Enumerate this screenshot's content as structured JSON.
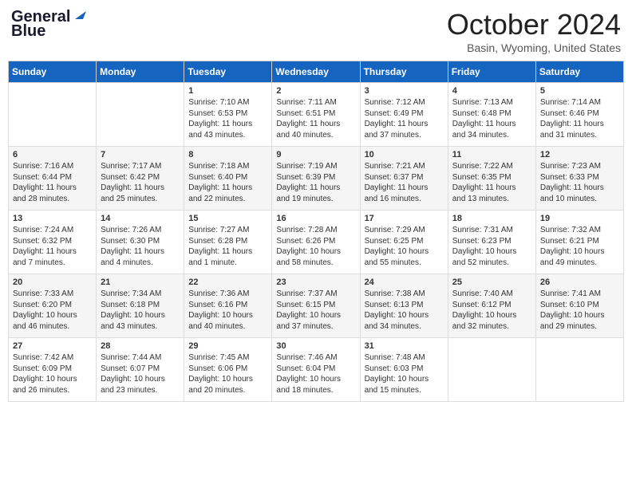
{
  "logo": {
    "line1": "General",
    "line2": "Blue"
  },
  "title": "October 2024",
  "location": "Basin, Wyoming, United States",
  "days_of_week": [
    "Sunday",
    "Monday",
    "Tuesday",
    "Wednesday",
    "Thursday",
    "Friday",
    "Saturday"
  ],
  "weeks": [
    [
      {
        "day": "",
        "content": ""
      },
      {
        "day": "",
        "content": ""
      },
      {
        "day": "1",
        "content": "Sunrise: 7:10 AM\nSunset: 6:53 PM\nDaylight: 11 hours and 43 minutes."
      },
      {
        "day": "2",
        "content": "Sunrise: 7:11 AM\nSunset: 6:51 PM\nDaylight: 11 hours and 40 minutes."
      },
      {
        "day": "3",
        "content": "Sunrise: 7:12 AM\nSunset: 6:49 PM\nDaylight: 11 hours and 37 minutes."
      },
      {
        "day": "4",
        "content": "Sunrise: 7:13 AM\nSunset: 6:48 PM\nDaylight: 11 hours and 34 minutes."
      },
      {
        "day": "5",
        "content": "Sunrise: 7:14 AM\nSunset: 6:46 PM\nDaylight: 11 hours and 31 minutes."
      }
    ],
    [
      {
        "day": "6",
        "content": "Sunrise: 7:16 AM\nSunset: 6:44 PM\nDaylight: 11 hours and 28 minutes."
      },
      {
        "day": "7",
        "content": "Sunrise: 7:17 AM\nSunset: 6:42 PM\nDaylight: 11 hours and 25 minutes."
      },
      {
        "day": "8",
        "content": "Sunrise: 7:18 AM\nSunset: 6:40 PM\nDaylight: 11 hours and 22 minutes."
      },
      {
        "day": "9",
        "content": "Sunrise: 7:19 AM\nSunset: 6:39 PM\nDaylight: 11 hours and 19 minutes."
      },
      {
        "day": "10",
        "content": "Sunrise: 7:21 AM\nSunset: 6:37 PM\nDaylight: 11 hours and 16 minutes."
      },
      {
        "day": "11",
        "content": "Sunrise: 7:22 AM\nSunset: 6:35 PM\nDaylight: 11 hours and 13 minutes."
      },
      {
        "day": "12",
        "content": "Sunrise: 7:23 AM\nSunset: 6:33 PM\nDaylight: 11 hours and 10 minutes."
      }
    ],
    [
      {
        "day": "13",
        "content": "Sunrise: 7:24 AM\nSunset: 6:32 PM\nDaylight: 11 hours and 7 minutes."
      },
      {
        "day": "14",
        "content": "Sunrise: 7:26 AM\nSunset: 6:30 PM\nDaylight: 11 hours and 4 minutes."
      },
      {
        "day": "15",
        "content": "Sunrise: 7:27 AM\nSunset: 6:28 PM\nDaylight: 11 hours and 1 minute."
      },
      {
        "day": "16",
        "content": "Sunrise: 7:28 AM\nSunset: 6:26 PM\nDaylight: 10 hours and 58 minutes."
      },
      {
        "day": "17",
        "content": "Sunrise: 7:29 AM\nSunset: 6:25 PM\nDaylight: 10 hours and 55 minutes."
      },
      {
        "day": "18",
        "content": "Sunrise: 7:31 AM\nSunset: 6:23 PM\nDaylight: 10 hours and 52 minutes."
      },
      {
        "day": "19",
        "content": "Sunrise: 7:32 AM\nSunset: 6:21 PM\nDaylight: 10 hours and 49 minutes."
      }
    ],
    [
      {
        "day": "20",
        "content": "Sunrise: 7:33 AM\nSunset: 6:20 PM\nDaylight: 10 hours and 46 minutes."
      },
      {
        "day": "21",
        "content": "Sunrise: 7:34 AM\nSunset: 6:18 PM\nDaylight: 10 hours and 43 minutes."
      },
      {
        "day": "22",
        "content": "Sunrise: 7:36 AM\nSunset: 6:16 PM\nDaylight: 10 hours and 40 minutes."
      },
      {
        "day": "23",
        "content": "Sunrise: 7:37 AM\nSunset: 6:15 PM\nDaylight: 10 hours and 37 minutes."
      },
      {
        "day": "24",
        "content": "Sunrise: 7:38 AM\nSunset: 6:13 PM\nDaylight: 10 hours and 34 minutes."
      },
      {
        "day": "25",
        "content": "Sunrise: 7:40 AM\nSunset: 6:12 PM\nDaylight: 10 hours and 32 minutes."
      },
      {
        "day": "26",
        "content": "Sunrise: 7:41 AM\nSunset: 6:10 PM\nDaylight: 10 hours and 29 minutes."
      }
    ],
    [
      {
        "day": "27",
        "content": "Sunrise: 7:42 AM\nSunset: 6:09 PM\nDaylight: 10 hours and 26 minutes."
      },
      {
        "day": "28",
        "content": "Sunrise: 7:44 AM\nSunset: 6:07 PM\nDaylight: 10 hours and 23 minutes."
      },
      {
        "day": "29",
        "content": "Sunrise: 7:45 AM\nSunset: 6:06 PM\nDaylight: 10 hours and 20 minutes."
      },
      {
        "day": "30",
        "content": "Sunrise: 7:46 AM\nSunset: 6:04 PM\nDaylight: 10 hours and 18 minutes."
      },
      {
        "day": "31",
        "content": "Sunrise: 7:48 AM\nSunset: 6:03 PM\nDaylight: 10 hours and 15 minutes."
      },
      {
        "day": "",
        "content": ""
      },
      {
        "day": "",
        "content": ""
      }
    ]
  ]
}
